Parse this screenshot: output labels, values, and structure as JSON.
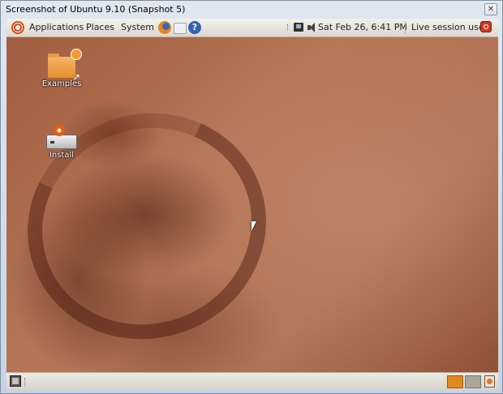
{
  "window": {
    "title": "Screenshot of Ubuntu 9.10 (Snapshot 5)",
    "close_glyph": "✕"
  },
  "top_panel": {
    "menus": [
      "Applications",
      "Places",
      "System"
    ],
    "launchers": [
      "firefox-icon",
      "mail-icon",
      "help-icon"
    ],
    "help_glyph": "?",
    "clock": "Sat Feb 26,  6:41 PM",
    "session": "Live session user"
  },
  "desktop": {
    "icons": [
      {
        "label": "Examples",
        "icon": "folder-icon"
      },
      {
        "label": "Install",
        "icon": "install-icon"
      }
    ]
  },
  "bottom_panel": {
    "workspaces": 2,
    "active_workspace": 1
  },
  "colors": {
    "accent_orange": "#e08a1e",
    "wallpaper_brown": "#a25e40",
    "ubuntu_orange": "#dd4814"
  }
}
